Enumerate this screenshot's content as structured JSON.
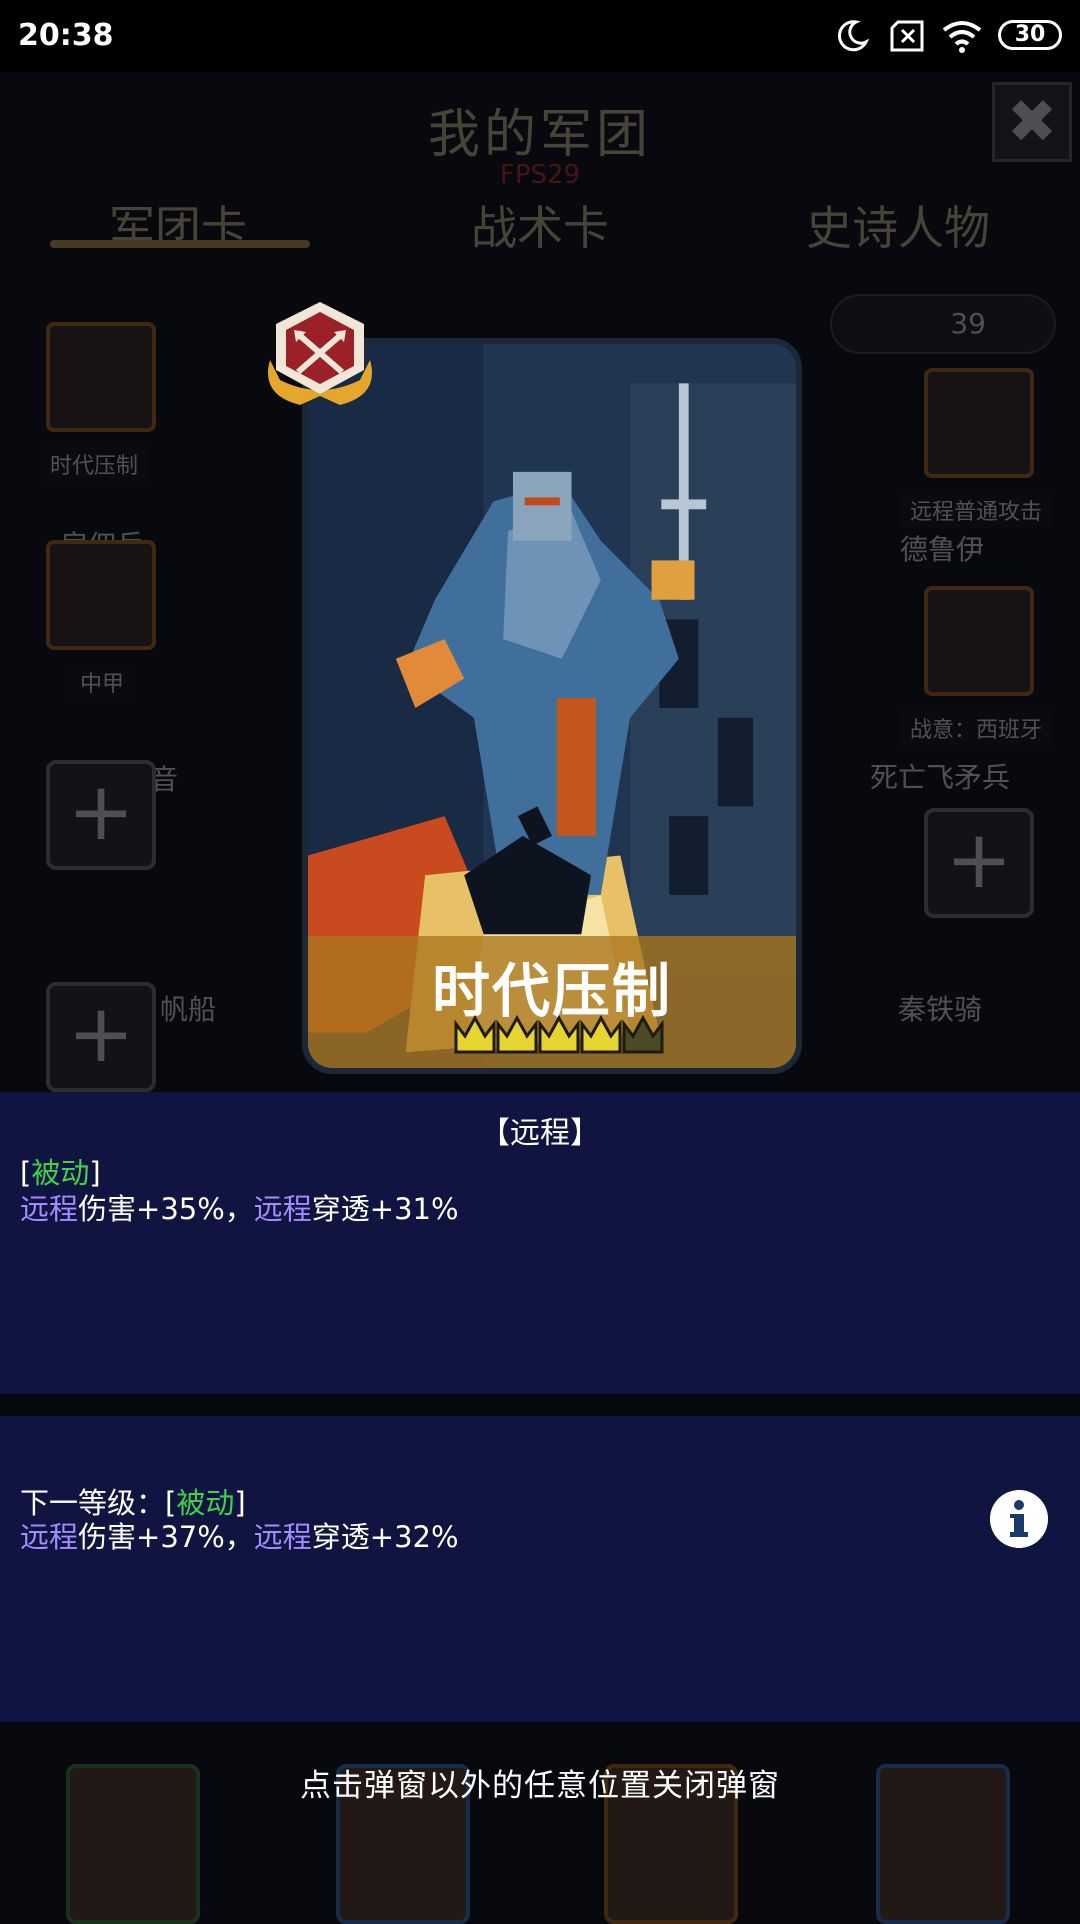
{
  "status_bar": {
    "time": "20:38",
    "battery": "30",
    "icons": [
      "moon-icon",
      "sim-off-icon",
      "wifi-icon",
      "battery-icon"
    ]
  },
  "background": {
    "title": "我的军团",
    "fps": "FPS29",
    "tabs": [
      "军团卡",
      "战术卡",
      "史诗人物"
    ],
    "resource_count": "39",
    "left_slots": [
      {
        "tag": "时代压制",
        "label": "雇佣兵"
      },
      {
        "tag": "中甲",
        "label": "音"
      }
    ],
    "right_slots": [
      {
        "tag": "远程普通攻击",
        "label": "德鲁伊"
      },
      {
        "tag": "战意：西班牙",
        "label": "死亡飞矛兵"
      }
    ],
    "other_labels": [
      "帆船",
      "秦铁骑"
    ]
  },
  "card": {
    "title": "时代压制",
    "stars_total": 5,
    "stars_filled": 4
  },
  "details": {
    "type_label": "【远程】",
    "current": {
      "tag_open": "[",
      "tag": "被动",
      "tag_close": "]",
      "kw1": "远程",
      "text1": "伤害+35%，",
      "kw2": "远程",
      "text2": "穿透+31%"
    },
    "next": {
      "prefix": "下一等级：[",
      "tag": "被动",
      "tag_close": "]",
      "kw1": "远程",
      "text1": "伤害+37%，",
      "kw2": "远程",
      "text2": "穿透+32%"
    }
  },
  "hint": "点击弹窗以外的任意位置关闭弹窗",
  "colors": {
    "passive": "#3ed24a",
    "keyword": "#a58bff",
    "panel": "#10163f",
    "gold": "#c7a24a"
  }
}
